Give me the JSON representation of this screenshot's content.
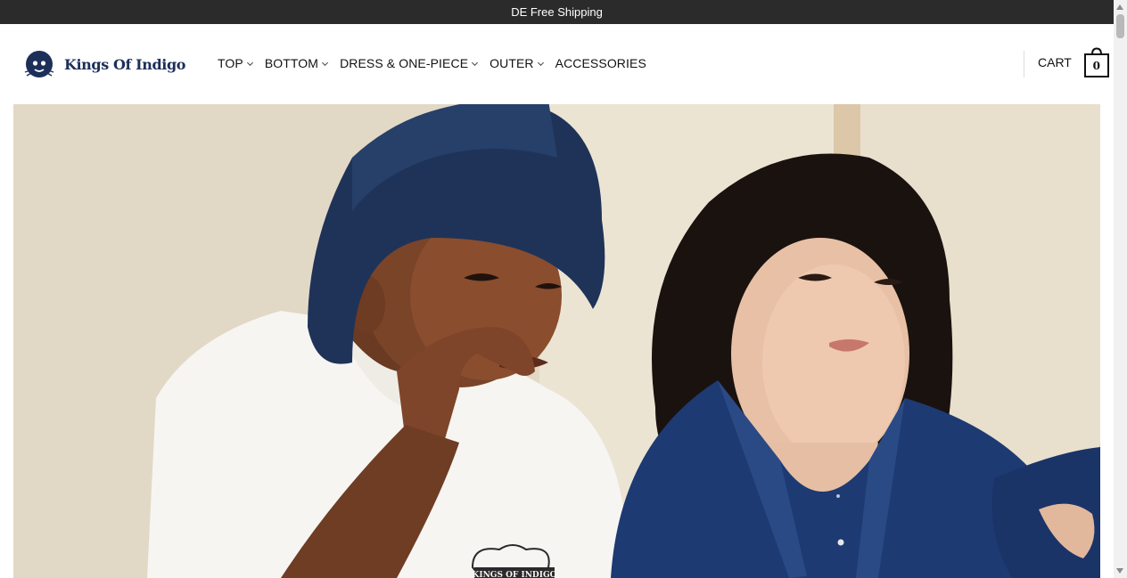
{
  "announcement": {
    "text": "DE Free Shipping"
  },
  "brand": {
    "name": "Kings Of Indigo",
    "color": "#1c2f59"
  },
  "nav": {
    "items": [
      {
        "label": "TOP",
        "has_dropdown": true
      },
      {
        "label": "BOTTOM",
        "has_dropdown": true
      },
      {
        "label": "DRESS & ONE-PIECE",
        "has_dropdown": true
      },
      {
        "label": "OUTER",
        "has_dropdown": true
      },
      {
        "label": "ACCESSORIES",
        "has_dropdown": false
      }
    ]
  },
  "cart": {
    "label": "CART",
    "count": "0"
  },
  "hero": {
    "tshirt_print": "KINGS OF INDIGO"
  }
}
